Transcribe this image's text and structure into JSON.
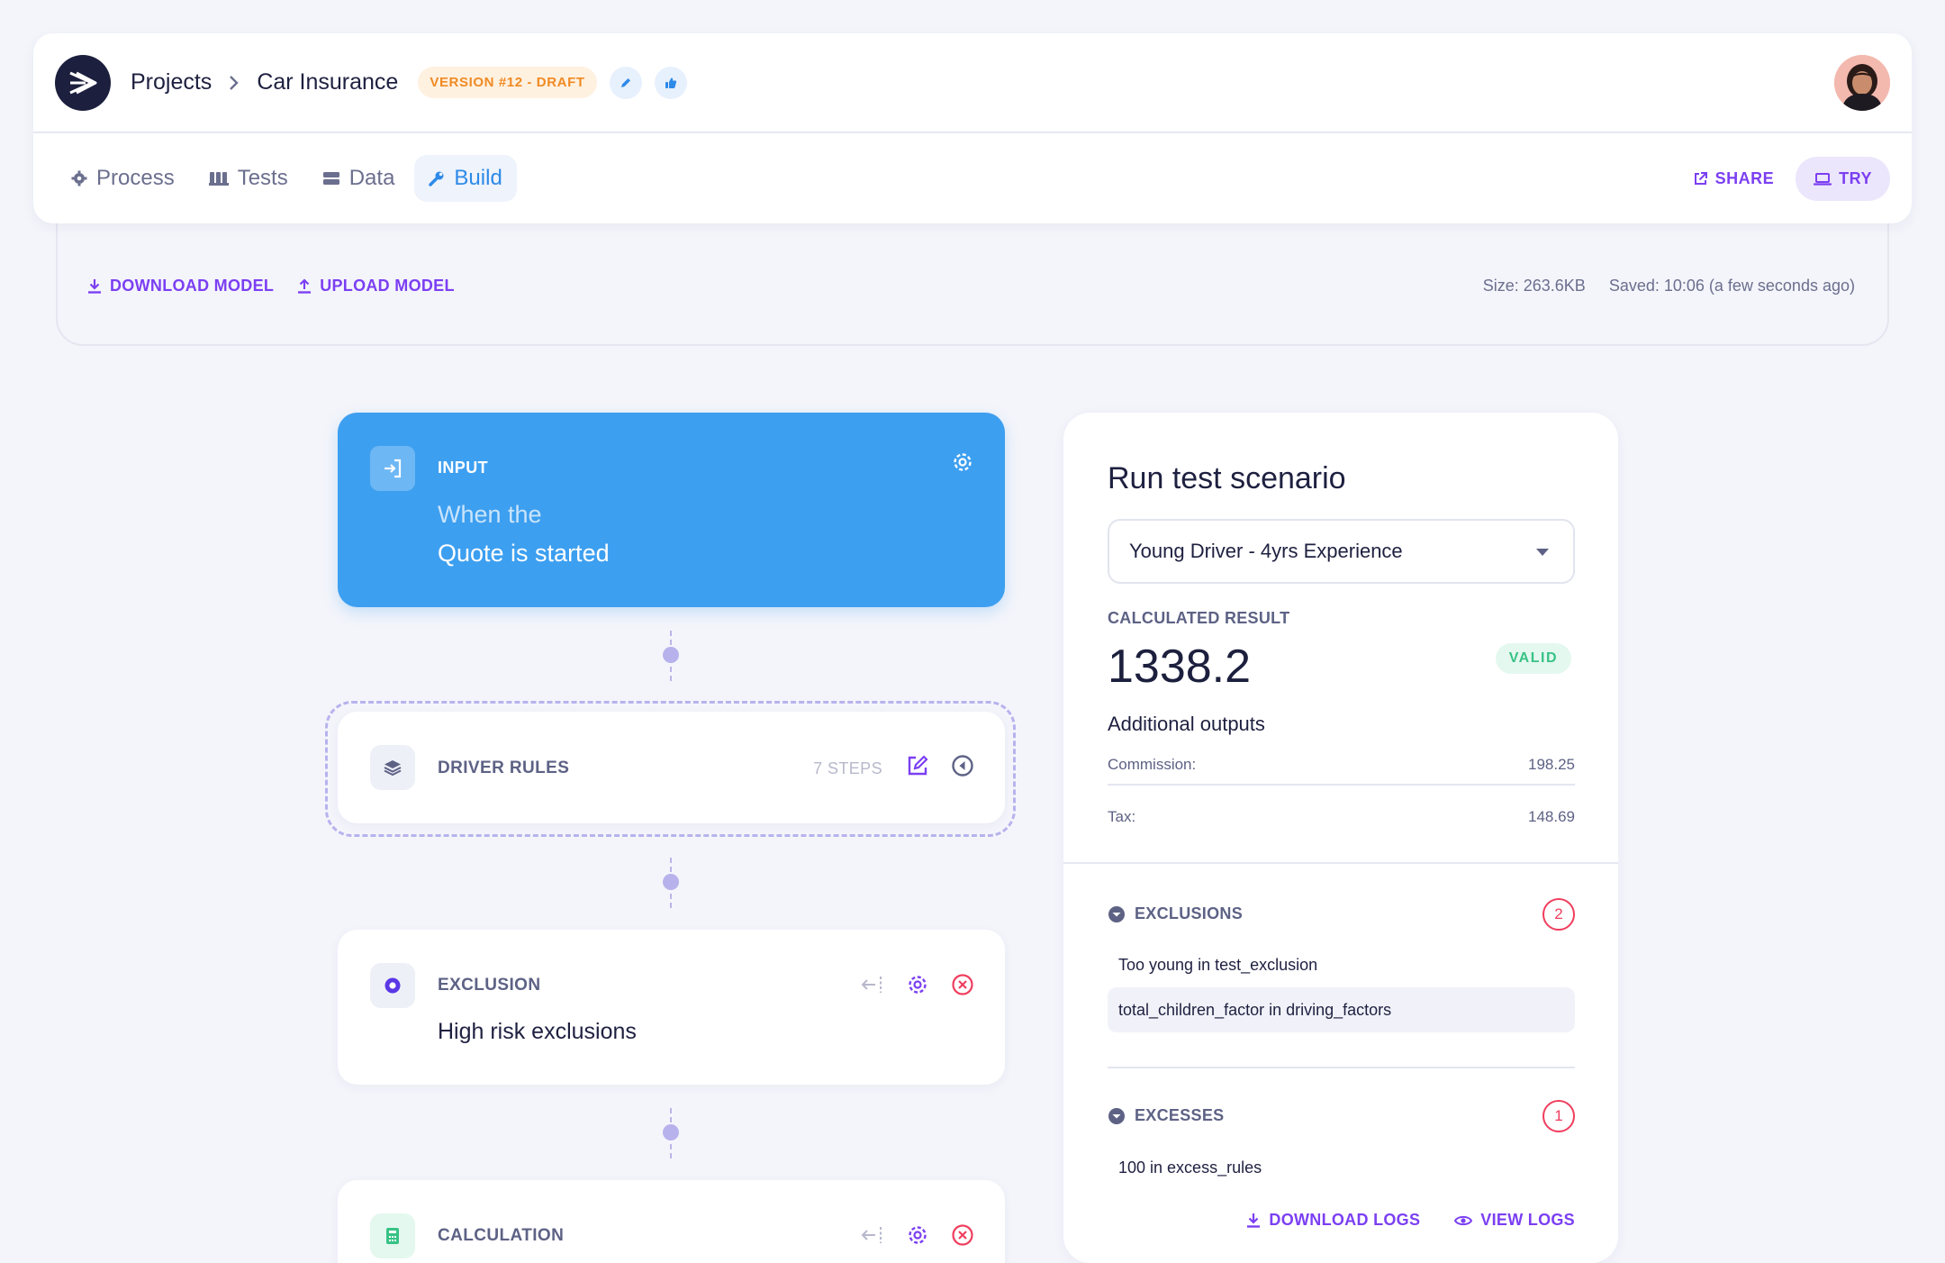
{
  "header": {
    "breadcrumb": {
      "root": "Projects",
      "current": "Car Insurance"
    },
    "version_badge": "VERSION #12 - DRAFT",
    "accent": "#7b3ff2"
  },
  "nav": {
    "tabs": [
      {
        "label": "Process",
        "icon": "gear-icon"
      },
      {
        "label": "Tests",
        "icon": "flask-icon"
      },
      {
        "label": "Data",
        "icon": "database-icon"
      },
      {
        "label": "Build",
        "icon": "wrench-icon",
        "active": true
      }
    ],
    "share_label": "SHARE",
    "try_label": "TRY"
  },
  "toolbar": {
    "download_label": "DOWNLOAD MODEL",
    "upload_label": "UPLOAD MODEL",
    "size": "Size: 263.6KB",
    "saved": "Saved: 10:06 (a few seconds ago)"
  },
  "flow": {
    "input": {
      "label": "INPUT",
      "sub": "When the",
      "main": "Quote is started",
      "color": "#3d9ff0"
    },
    "driver_rules": {
      "label": "DRIVER RULES",
      "steps": "7 STEPS"
    },
    "exclusion": {
      "label": "EXCLUSION",
      "main": "High risk exclusions"
    },
    "calculation": {
      "label": "CALCULATION"
    }
  },
  "test_panel": {
    "title": "Run test scenario",
    "scenario": "Young Driver - 4yrs Experience",
    "calculated_label": "CALCULATED RESULT",
    "calculated_value": "1338.2",
    "status": "VALID",
    "additional_title": "Additional outputs",
    "outputs": [
      {
        "label": "Commission:",
        "value": "198.25"
      },
      {
        "label": "Tax:",
        "value": "148.69"
      }
    ],
    "exclusions": {
      "label": "EXCLUSIONS",
      "count": "2",
      "items": [
        "Too young in test_exclusion",
        "total_children_factor in driving_factors"
      ]
    },
    "excesses": {
      "label": "EXCESSES",
      "count": "1",
      "items": [
        "100 in excess_rules"
      ]
    },
    "download_logs": "DOWNLOAD LOGS",
    "view_logs": "VIEW LOGS"
  }
}
